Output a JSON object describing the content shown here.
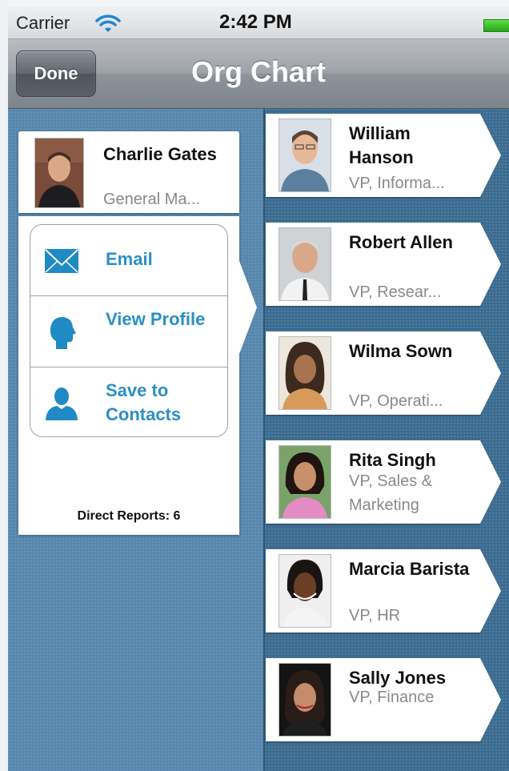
{
  "status_bar": {
    "carrier": "Carrier",
    "time": "2:42 PM"
  },
  "nav": {
    "done_label": "Done",
    "title": "Org Chart"
  },
  "selected": {
    "name": "Charlie Gates",
    "title": "General Ma...",
    "actions": [
      {
        "label": "Email",
        "icon": "envelope-icon"
      },
      {
        "label": "View Profile",
        "icon": "profile-head-icon"
      },
      {
        "label": "Save to Contacts",
        "icon": "contact-person-icon"
      }
    ],
    "direct_reports_label": "Direct Reports: 6"
  },
  "reports": [
    {
      "name": "William Hanson",
      "title": "VP, Informa..."
    },
    {
      "name": "Robert Allen",
      "title": "VP, Resear..."
    },
    {
      "name": "Wilma Sown",
      "title": "VP, Operati..."
    },
    {
      "name": "Rita Singh",
      "title": "VP, Sales & Marketing"
    },
    {
      "name": "Marcia Barista",
      "title": "VP, HR"
    },
    {
      "name": "Sally Jones",
      "title": "VP, Finance"
    }
  ],
  "colors": {
    "link_blue": "#2a8fc6",
    "background_blue": "#5887ad",
    "battery_green": "#3cc62a"
  }
}
